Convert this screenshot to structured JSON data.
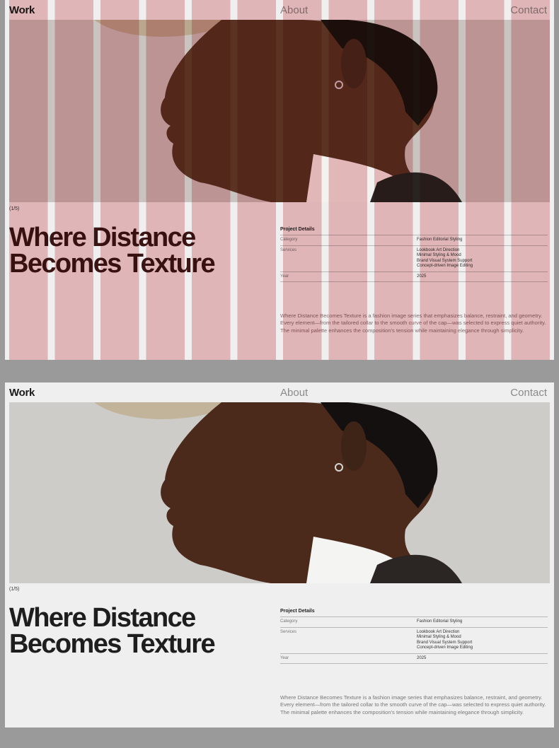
{
  "nav": {
    "work": "Work",
    "about": "About",
    "contact": "Contact"
  },
  "counter": "(1/5)",
  "headline": {
    "line1": "Where Distance",
    "line2": "Becomes Texture"
  },
  "details": {
    "title": "Project Details",
    "rows": [
      {
        "label": "Category",
        "value": "Fashion Editorial Styling"
      },
      {
        "label": "Services",
        "value": "Lookbook Art Direction\nMinimal Styling & Mood\nBrand Visual System Support\nConcept-driven Image Editing"
      },
      {
        "label": "Year",
        "value": "2025"
      }
    ]
  },
  "description": "Where Distance Becomes Texture is a fashion image series that emphasizes balance, restraint, and geometry. Every element—from the tailored collar to the smooth curve of the cap—was selected to express quiet authority. The minimal palette enhances the composition's tension while maintaining elegance through simplicity.",
  "colors": {
    "grid_overlay": "#e8a9ad",
    "page_bg": "#efefef",
    "frame_bg": "#9a9a9a"
  },
  "icons": {
    "photo": "portrait-photo"
  }
}
